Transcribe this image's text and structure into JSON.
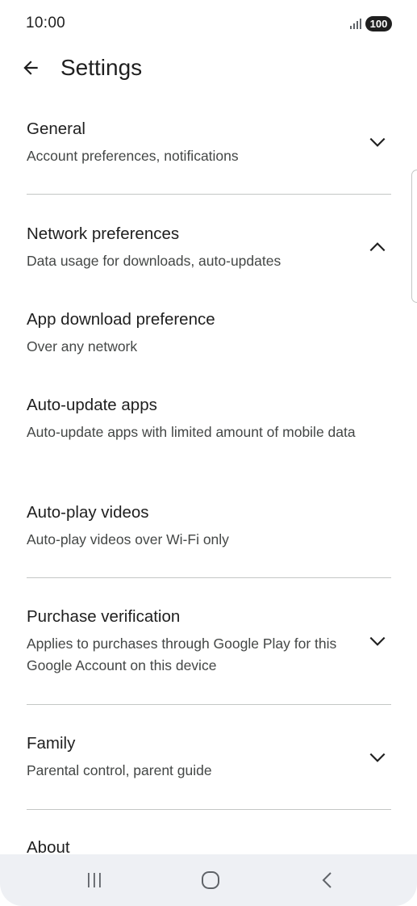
{
  "status_bar": {
    "time": "10:00",
    "battery": "100",
    "signal_icon": "signal-bars-icon"
  },
  "app_bar": {
    "title": "Settings",
    "back_icon": "back-arrow-icon"
  },
  "settings": {
    "general": {
      "title": "General",
      "subtitle": "Account preferences, notifications",
      "expanded": false
    },
    "network": {
      "title": "Network preferences",
      "subtitle": "Data usage for downloads, auto-updates",
      "expanded": true
    },
    "app_download": {
      "title": "App download preference",
      "subtitle": "Over any network"
    },
    "auto_update": {
      "title": "Auto-update apps",
      "subtitle": "Auto-update apps with limited amount of mobile data"
    },
    "auto_play": {
      "title": "Auto-play videos",
      "subtitle": "Auto-play videos over Wi-Fi only"
    },
    "purchase": {
      "title": "Purchase verification",
      "subtitle": "Applies to purchases through Google Play for this Google Account on this device",
      "expanded": false
    },
    "family": {
      "title": "Family",
      "subtitle": "Parental control, parent guide",
      "expanded": false
    },
    "about": {
      "title": "About"
    }
  },
  "nav_bar": {
    "recents_icon": "recents-icon",
    "home_icon": "home-icon",
    "back_icon": "nav-back-icon"
  },
  "colors": {
    "text_primary": "#1f1f1f",
    "text_secondary": "#444746",
    "divider": "#c4c7c5",
    "nav_background": "#eef0f4"
  }
}
